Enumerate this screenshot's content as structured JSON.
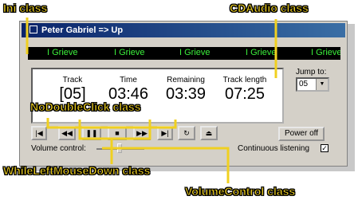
{
  "window": {
    "title": "Peter Gabriel => Up"
  },
  "marquee": {
    "items": [
      "I Grieve",
      "I Grieve",
      "I Grieve",
      "I Grieve",
      "I Grieve"
    ]
  },
  "display": {
    "track_label": "Track",
    "track_value": "[05]",
    "time_label": "Time",
    "time_value": "03:46",
    "remaining_label": "Remaining",
    "remaining_value": "03:39",
    "length_label": "Track length",
    "length_value": "07:25"
  },
  "jump": {
    "label": "Jump to:",
    "value": "05"
  },
  "controls": {
    "prev_icon": "skip-back-icon",
    "rew_icon": "rewind-icon",
    "pause_icon": "pause-icon",
    "stop_icon": "stop-icon",
    "ff_icon": "fast-forward-icon",
    "next_icon": "skip-forward-icon",
    "repeat_icon": "repeat-icon",
    "eject_icon": "eject-icon",
    "power_label": "Power off"
  },
  "volume": {
    "label": "Volume control:",
    "level": 0.45
  },
  "continuous": {
    "label": "Continuous listening",
    "checked": true
  },
  "annotations": {
    "ini": "Ini class",
    "cdaudio": "CDAudio class",
    "nodouble": "NoDoubleClick class",
    "whileleft": "WhileLeftMouseDown class",
    "volumecontrol": "VolumeControl class"
  },
  "colors": {
    "annotation": "#f0d020",
    "marquee_text": "#3cf03c",
    "title_bar": "#0a246a"
  }
}
